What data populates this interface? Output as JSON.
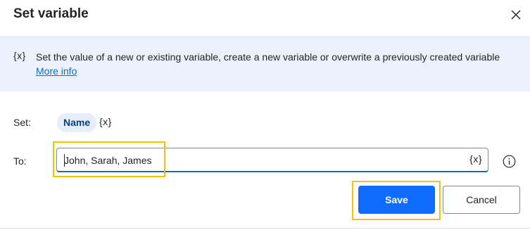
{
  "dialog": {
    "title": "Set variable",
    "close_icon": "close-icon"
  },
  "banner": {
    "icon_text": "{x}",
    "text": "Set the value of a new or existing variable, create a new variable or overwrite a previously created variable ",
    "link_text": "More info"
  },
  "form": {
    "set_label": "Set:",
    "variable_name": "Name",
    "variable_token": "{x}",
    "to_label": "To:",
    "to_value": "John, Sarah, James",
    "to_token": "{x}",
    "info_icon": "info-icon"
  },
  "buttons": {
    "save_label": "Save",
    "cancel_label": "Cancel"
  },
  "colors": {
    "primary": "#0f6cfd",
    "link": "#0f6cbd",
    "banner_bg": "#eaf1fb",
    "highlight": "#f2c200"
  }
}
